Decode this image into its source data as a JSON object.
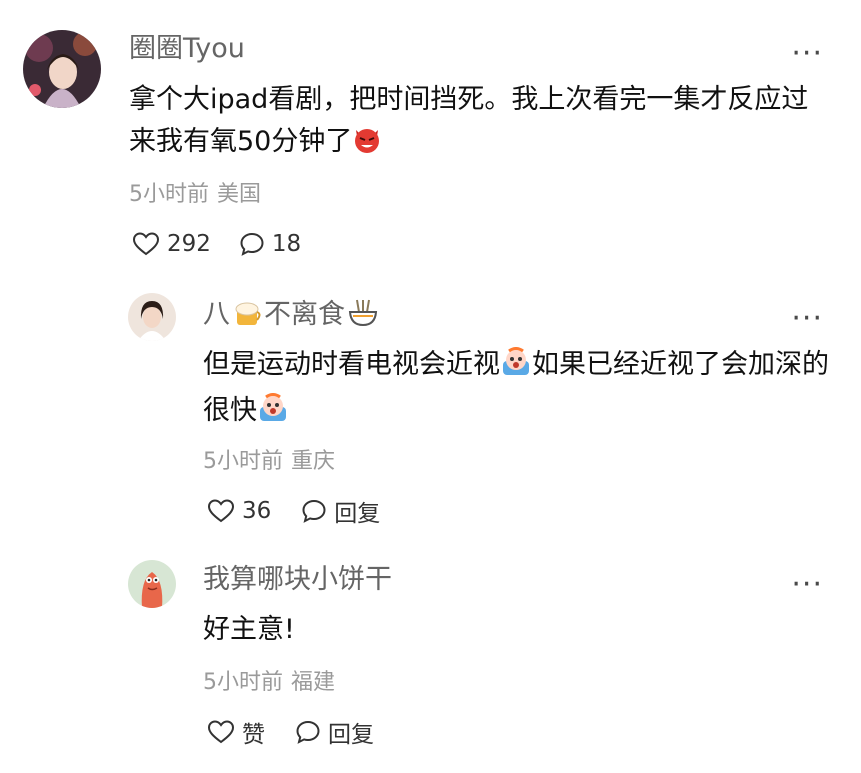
{
  "comments": [
    {
      "username": "圈圈Tyou",
      "text_part1": "拿个大ipad看剧，把时间挡死。我上次看完一集才反应过来我有氧50分钟了",
      "emoji": "devil-emoji",
      "time": "5小时前",
      "location": "美国",
      "likes": "292",
      "replies": "18",
      "avatar_color": "#2d1c2a"
    },
    {
      "username_part1": "八",
      "username_part2": "不离食",
      "text_part1": "但是运动时看电视会近视",
      "text_part2": "如果已经近视了会加深的很快",
      "emoji": "scared-face-emoji",
      "time": "5小时前",
      "location": "重庆",
      "likes": "36",
      "reply_label": "回复",
      "avatar_color": "#e8d9cf"
    },
    {
      "username": "我算哪块小饼干",
      "text_part1": "好主意!",
      "time": "5小时前",
      "location": "福建",
      "like_label": "赞",
      "reply_label": "回复",
      "avatar_color": "#cfe2ce"
    }
  ],
  "more_glyph": "···",
  "icons": {
    "like": "heart-outline-icon",
    "reply": "speech-bubble-icon",
    "more": "more-dots-icon"
  },
  "colors": {
    "username": "#656565",
    "meta": "#9a9a9a",
    "content": "#111111"
  }
}
